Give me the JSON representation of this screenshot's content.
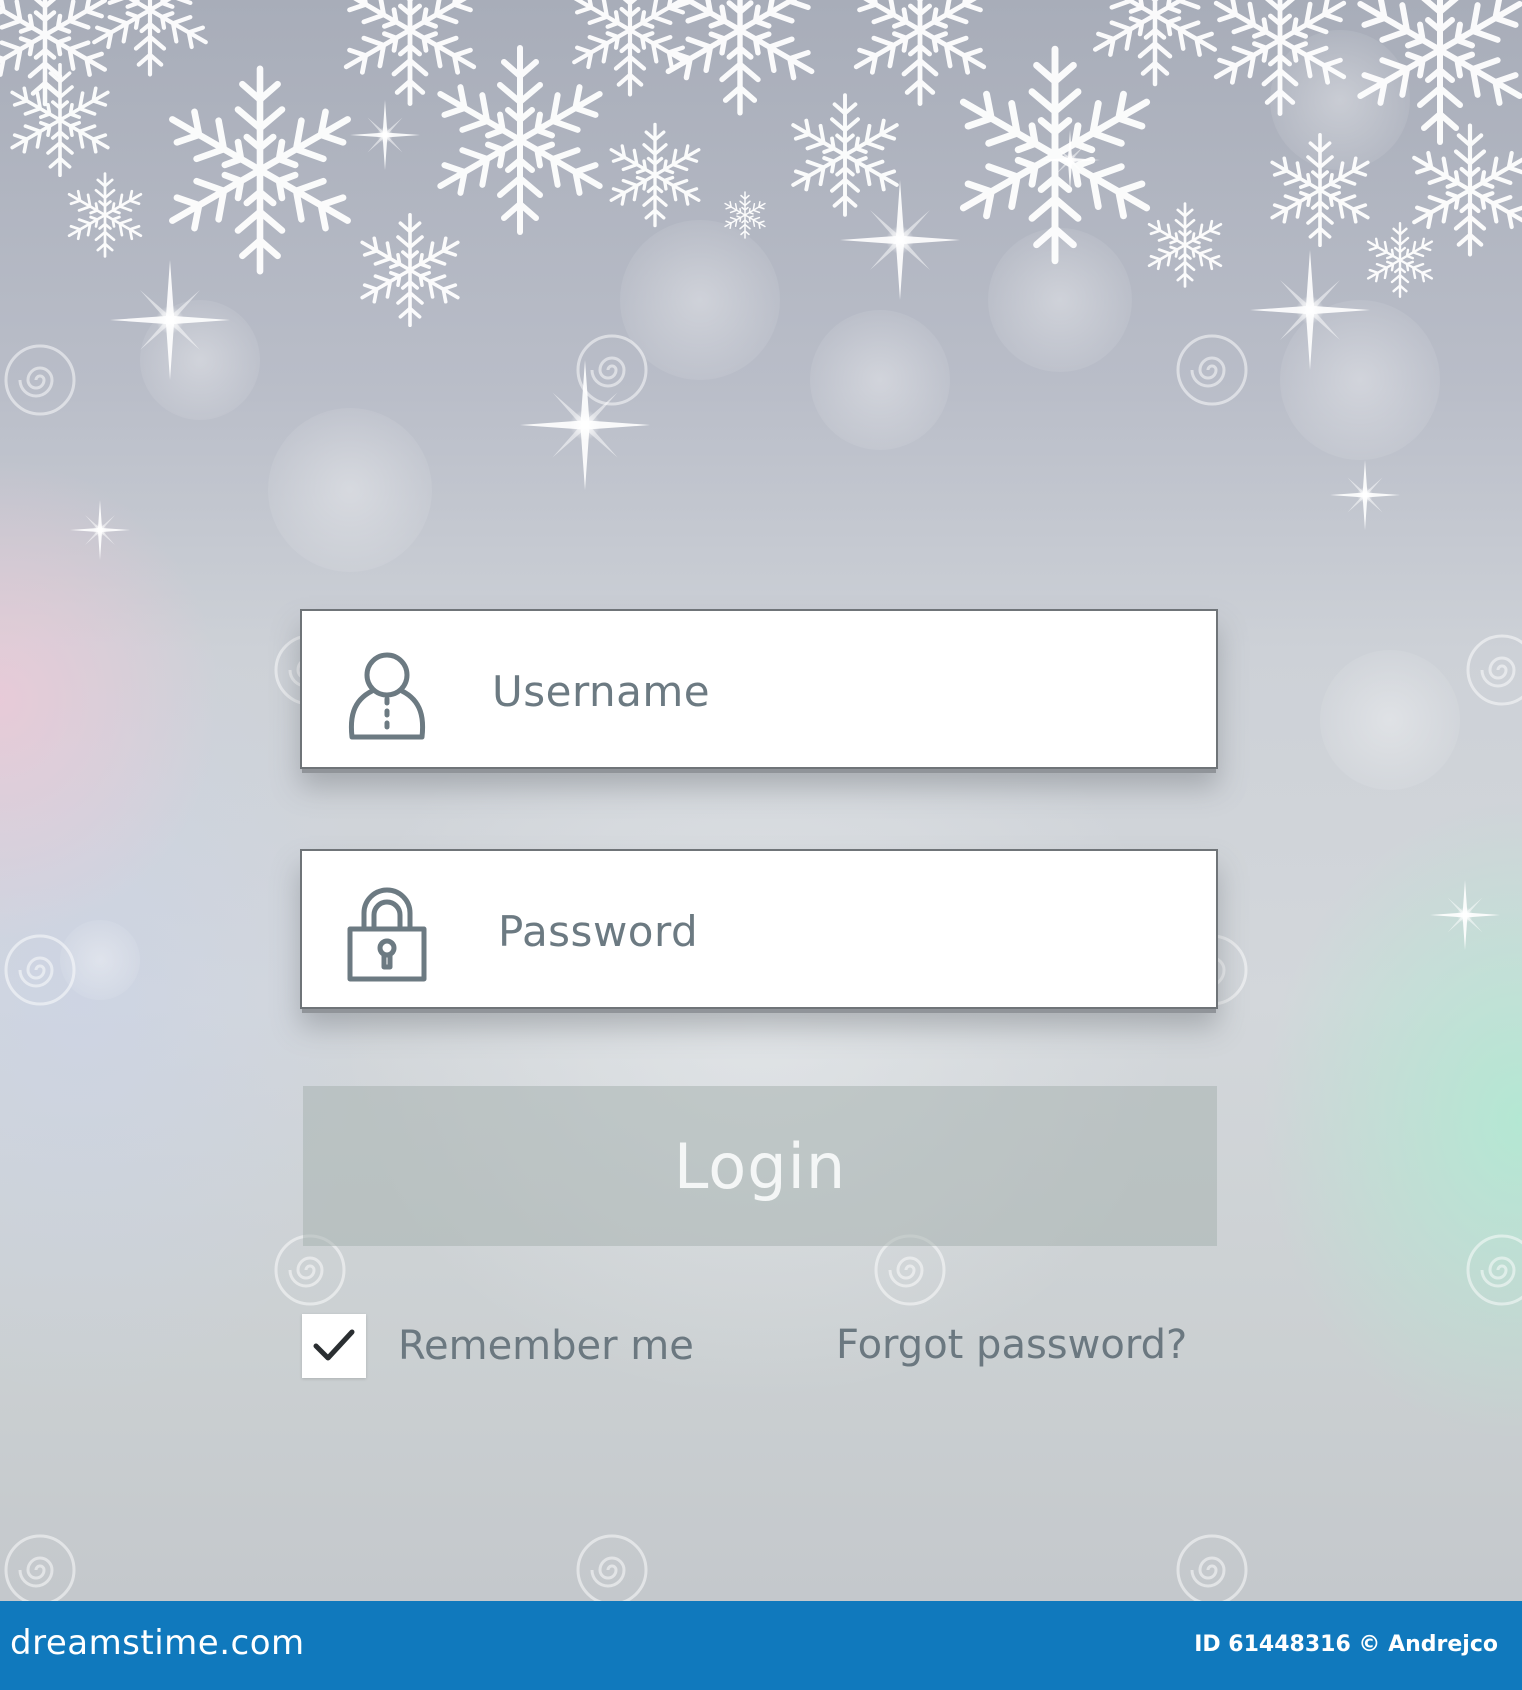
{
  "login_form": {
    "username_placeholder": "Username",
    "password_placeholder": "Password",
    "login_label": "Login",
    "remember_label": "Remember me",
    "remember_checked": true,
    "forgot_label": "Forgot password?"
  },
  "icons": {
    "username": "user-icon",
    "password": "padlock-icon",
    "remember": "checkmark-icon"
  },
  "watermark": {
    "site": "dreamstime.com",
    "repeated_text": "dreamstime"
  },
  "footer": {
    "site": "dreamstime.com",
    "credit": "ID 61448316 © Andrejco"
  },
  "colors": {
    "footer_bg": "#1079bd",
    "text": "#6b7880",
    "field_bg": "#ffffff"
  }
}
